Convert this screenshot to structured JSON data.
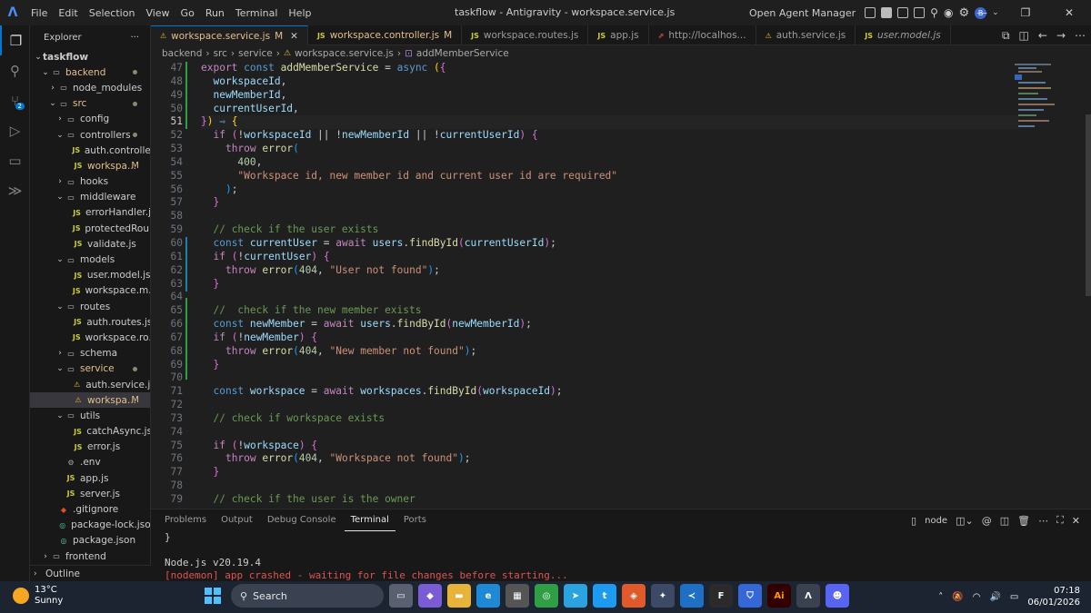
{
  "titlebar": {
    "menu": [
      "File",
      "Edit",
      "Selection",
      "View",
      "Go",
      "Run",
      "Terminal",
      "Help"
    ],
    "window_title": "taskflow - Antigravity - workspace.service.js",
    "agent_manager": "Open Agent Manager",
    "avatar_letter": "B"
  },
  "explorer": {
    "title": "Explorer",
    "more": "···",
    "outline": "Outline",
    "tree": [
      {
        "label": "taskflow",
        "depth": 0,
        "type": "folder-open"
      },
      {
        "label": "backend",
        "depth": 1,
        "type": "folder-open",
        "dot": true,
        "mod": true
      },
      {
        "label": "node_modules",
        "depth": 2,
        "type": "folder"
      },
      {
        "label": "src",
        "depth": 2,
        "type": "folder-open",
        "dot": true,
        "mod": true
      },
      {
        "label": "config",
        "depth": 3,
        "type": "folder"
      },
      {
        "label": "controllers",
        "depth": 3,
        "type": "folder-open",
        "dot": true
      },
      {
        "label": "auth.controlle...",
        "depth": 4,
        "type": "js"
      },
      {
        "label": "workspa...",
        "depth": 4,
        "type": "js",
        "marker": "M",
        "mod": true
      },
      {
        "label": "hooks",
        "depth": 3,
        "type": "folder"
      },
      {
        "label": "middleware",
        "depth": 3,
        "type": "folder-open"
      },
      {
        "label": "errorHandler.js",
        "depth": 4,
        "type": "js"
      },
      {
        "label": "protectedRou...",
        "depth": 4,
        "type": "js"
      },
      {
        "label": "validate.js",
        "depth": 4,
        "type": "js"
      },
      {
        "label": "models",
        "depth": 3,
        "type": "folder-open"
      },
      {
        "label": "user.model.js",
        "depth": 4,
        "type": "js"
      },
      {
        "label": "workspace.m...",
        "depth": 4,
        "type": "js"
      },
      {
        "label": "routes",
        "depth": 3,
        "type": "folder-open"
      },
      {
        "label": "auth.routes.js",
        "depth": 4,
        "type": "js"
      },
      {
        "label": "workspace.ro...",
        "depth": 4,
        "type": "js"
      },
      {
        "label": "schema",
        "depth": 3,
        "type": "folder"
      },
      {
        "label": "service",
        "depth": 3,
        "type": "folder-open",
        "dot": true,
        "mod": true
      },
      {
        "label": "auth.service.js",
        "depth": 4,
        "type": "ag"
      },
      {
        "label": "workspa...",
        "depth": 4,
        "type": "ag",
        "marker": "M",
        "selected": true,
        "mod": true
      },
      {
        "label": "utils",
        "depth": 3,
        "type": "folder-open"
      },
      {
        "label": "catchAsync.js",
        "depth": 4,
        "type": "js"
      },
      {
        "label": "error.js",
        "depth": 4,
        "type": "js"
      },
      {
        "label": ".env",
        "depth": 3,
        "type": "gear"
      },
      {
        "label": "app.js",
        "depth": 3,
        "type": "js"
      },
      {
        "label": "server.js",
        "depth": 3,
        "type": "js"
      },
      {
        "label": ".gitignore",
        "depth": 2,
        "type": "git"
      },
      {
        "label": "package-lock.json",
        "depth": 2,
        "type": "json"
      },
      {
        "label": "package.json",
        "depth": 2,
        "type": "json"
      },
      {
        "label": "frontend",
        "depth": 1,
        "type": "folder"
      }
    ]
  },
  "tabs": [
    {
      "label": "workspace.service.js",
      "icon": "ag",
      "marker": "M",
      "active": true,
      "close": "✕"
    },
    {
      "label": "workspace.controller.js",
      "icon": "JS",
      "marker": "M"
    },
    {
      "label": "workspace.routes.js",
      "icon": "JS"
    },
    {
      "label": "app.js",
      "icon": "JS"
    },
    {
      "label": "http://localhos...",
      "icon": "link"
    },
    {
      "label": "auth.service.js",
      "icon": "ag"
    },
    {
      "label": "user.model.js",
      "icon": "JS"
    }
  ],
  "breadcrumb": [
    "backend",
    "src",
    "service",
    "workspace.service.js",
    "addMemberService"
  ],
  "editor": {
    "current_line": 51,
    "lines": [
      {
        "n": "47",
        "html": "<span class='kw2'>export</span> <span class='kw'>const</span> <span class='fn'>addMemberService</span> = <span class='kw'>async</span> <span class='br1'>(</span><span class='br2'>{</span>"
      },
      {
        "n": "48",
        "html": "  <span class='var'>workspaceId</span>,"
      },
      {
        "n": "49",
        "html": "  <span class='var'>newMemberId</span>,"
      },
      {
        "n": "50",
        "html": "  <span class='var'>currentUserId</span>,"
      },
      {
        "n": "51",
        "html": "<span class='br2'>}</span><span class='br1'>)</span> <span class='kw'>⇒</span> <span class='br1'>{</span>"
      },
      {
        "n": "52",
        "html": "  <span class='kw2'>if</span> <span class='br2'>(</span>!<span class='var'>workspaceId</span> || !<span class='var'>newMemberId</span> || !<span class='var'>currentUserId</span><span class='br2'>)</span> <span class='br2'>{</span>"
      },
      {
        "n": "53",
        "html": "    <span class='kw2'>throw</span> <span class='fn'>error</span><span class='br3'>(</span>"
      },
      {
        "n": "54",
        "html": "      <span class='num'>400</span>,"
      },
      {
        "n": "55",
        "html": "      <span class='str'>\"Workspace id, new member id and current user id are required\"</span>"
      },
      {
        "n": "56",
        "html": "    <span class='br3'>)</span>;"
      },
      {
        "n": "57",
        "html": "  <span class='br2'>}</span>"
      },
      {
        "n": "58",
        "html": ""
      },
      {
        "n": "59",
        "html": "  <span class='cm'>// check if the user exists</span>"
      },
      {
        "n": "60",
        "html": "  <span class='kw'>const</span> <span class='var'>currentUser</span> = <span class='kw2'>await</span> <span class='var'>users</span>.<span class='fn'>findById</span><span class='br2'>(</span><span class='var'>currentUserId</span><span class='br2'>)</span>;"
      },
      {
        "n": "61",
        "html": "  <span class='kw2'>if</span> <span class='br2'>(</span>!<span class='var'>currentUser</span><span class='br2'>)</span> <span class='br2'>{</span>"
      },
      {
        "n": "62",
        "html": "    <span class='kw2'>throw</span> <span class='fn'>error</span><span class='br3'>(</span><span class='num'>404</span>, <span class='str'>\"User not found\"</span><span class='br3'>)</span>;"
      },
      {
        "n": "63",
        "html": "  <span class='br2'>}</span>"
      },
      {
        "n": "64",
        "html": ""
      },
      {
        "n": "65",
        "html": "  <span class='cm'>//  check if the new member exists</span>"
      },
      {
        "n": "66",
        "html": "  <span class='kw'>const</span> <span class='var'>newMember</span> = <span class='kw2'>await</span> <span class='var'>users</span>.<span class='fn'>findById</span><span class='br2'>(</span><span class='var'>newMemberId</span><span class='br2'>)</span>;"
      },
      {
        "n": "67",
        "html": "  <span class='kw2'>if</span> <span class='br2'>(</span>!<span class='var'>newMember</span><span class='br2'>)</span> <span class='br2'>{</span>"
      },
      {
        "n": "68",
        "html": "    <span class='kw2'>throw</span> <span class='fn'>error</span><span class='br3'>(</span><span class='num'>404</span>, <span class='str'>\"New member not found\"</span><span class='br3'>)</span>;"
      },
      {
        "n": "69",
        "html": "  <span class='br2'>}</span>"
      },
      {
        "n": "70",
        "html": ""
      },
      {
        "n": "71",
        "html": "  <span class='kw'>const</span> <span class='var'>workspace</span> = <span class='kw2'>await</span> <span class='var'>workspaces</span>.<span class='fn'>findById</span><span class='br2'>(</span><span class='var'>workspaceId</span><span class='br2'>)</span>;"
      },
      {
        "n": "72",
        "html": ""
      },
      {
        "n": "73",
        "html": "  <span class='cm'>// check if workspace exists</span>"
      },
      {
        "n": "74",
        "html": ""
      },
      {
        "n": "75",
        "html": "  <span class='kw2'>if</span> <span class='br2'>(</span>!<span class='var'>workspace</span><span class='br2'>)</span> <span class='br2'>{</span>"
      },
      {
        "n": "76",
        "html": "    <span class='kw2'>throw</span> <span class='fn'>error</span><span class='br3'>(</span><span class='num'>404</span>, <span class='str'>\"Workspace not found\"</span><span class='br3'>)</span>;"
      },
      {
        "n": "77",
        "html": "  <span class='br2'>}</span>"
      },
      {
        "n": "78",
        "html": ""
      },
      {
        "n": "79",
        "html": "  <span class='cm'>// check if the user is the owner</span>"
      }
    ]
  },
  "panel": {
    "tabs": [
      "Problems",
      "Output",
      "Debug Console",
      "Terminal",
      "Ports"
    ],
    "active_tab": "Terminal",
    "shell": "node",
    "terminal_lines": [
      "}",
      "",
      "Node.js v20.19.4",
      "[nodemon] app crashed - waiting for file changes before starting..."
    ]
  },
  "taskbar": {
    "temp": "13°C",
    "condition": "Sunny",
    "search_placeholder": "Search",
    "time": "07:18",
    "date": "06/01/2026"
  },
  "colors": {
    "accent": "#0078d4",
    "modified": "#e2c08d",
    "js_icon": "#cbcb41",
    "taskbar": "#1c2431"
  }
}
